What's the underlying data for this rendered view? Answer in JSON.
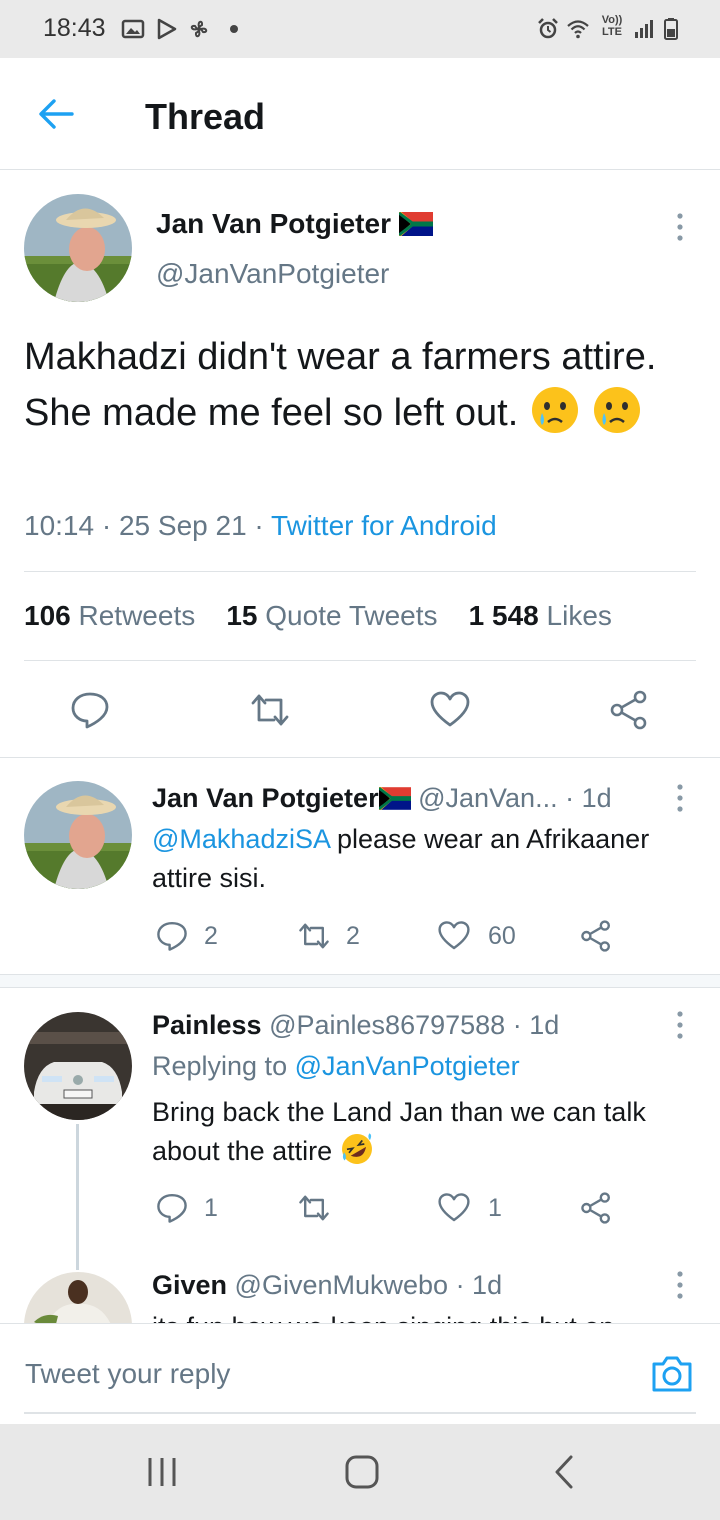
{
  "status_bar": {
    "time": "18:43",
    "left_icons": [
      "image-icon",
      "play-store-icon",
      "fan-icon",
      "dot-icon"
    ],
    "right_icons": [
      "alarm-icon",
      "wifi-icon",
      "volte-icon",
      "signal-icon",
      "battery-icon"
    ],
    "volte_label_top": "Vo))",
    "volte_label_bottom": "LTE"
  },
  "header": {
    "title": "Thread"
  },
  "main_tweet": {
    "name": "Jan Van Potgieter",
    "handle": "@JanVanPotgieter",
    "text": "Makhadzi didn't wear a farmers attire. She made me feel so left out.",
    "time": "10:14",
    "date": "25 Sep 21",
    "source": "Twitter for Android",
    "retweets_count": "106",
    "retweets_label": "Retweets",
    "quotes_count": "15",
    "quotes_label": "Quote Tweets",
    "likes_count": "1 548",
    "likes_label": "Likes"
  },
  "replies": [
    {
      "name": "Jan Van Potgieter",
      "handle": "@JanVan...",
      "age": "· 1d",
      "mention": "@MakhadziSA",
      "text": " please wear an Afrikaaner attire sisi.",
      "reply_count": "2",
      "retweet_count": "2",
      "like_count": "60"
    },
    {
      "name": "Painless",
      "handle": "@Painles86797588",
      "age": "· 1d",
      "replying_prefix": "Replying to",
      "replying_to": "@JanVanPotgieter",
      "text": "Bring back the Land Jan than we can talk about the attire",
      "reply_count": "1",
      "retweet_count": "",
      "like_count": "1"
    },
    {
      "name": "Given",
      "handle": "@GivenMukwebo",
      "age": "· 1d",
      "text": "its fun how we keep singing this but on"
    }
  ],
  "reply_bar": {
    "placeholder": "Tweet your reply"
  },
  "colors": {
    "accent": "#1da1f2",
    "link": "#1b95e0",
    "muted": "#657786",
    "text": "#14171a",
    "divider": "#dfe3e6"
  }
}
